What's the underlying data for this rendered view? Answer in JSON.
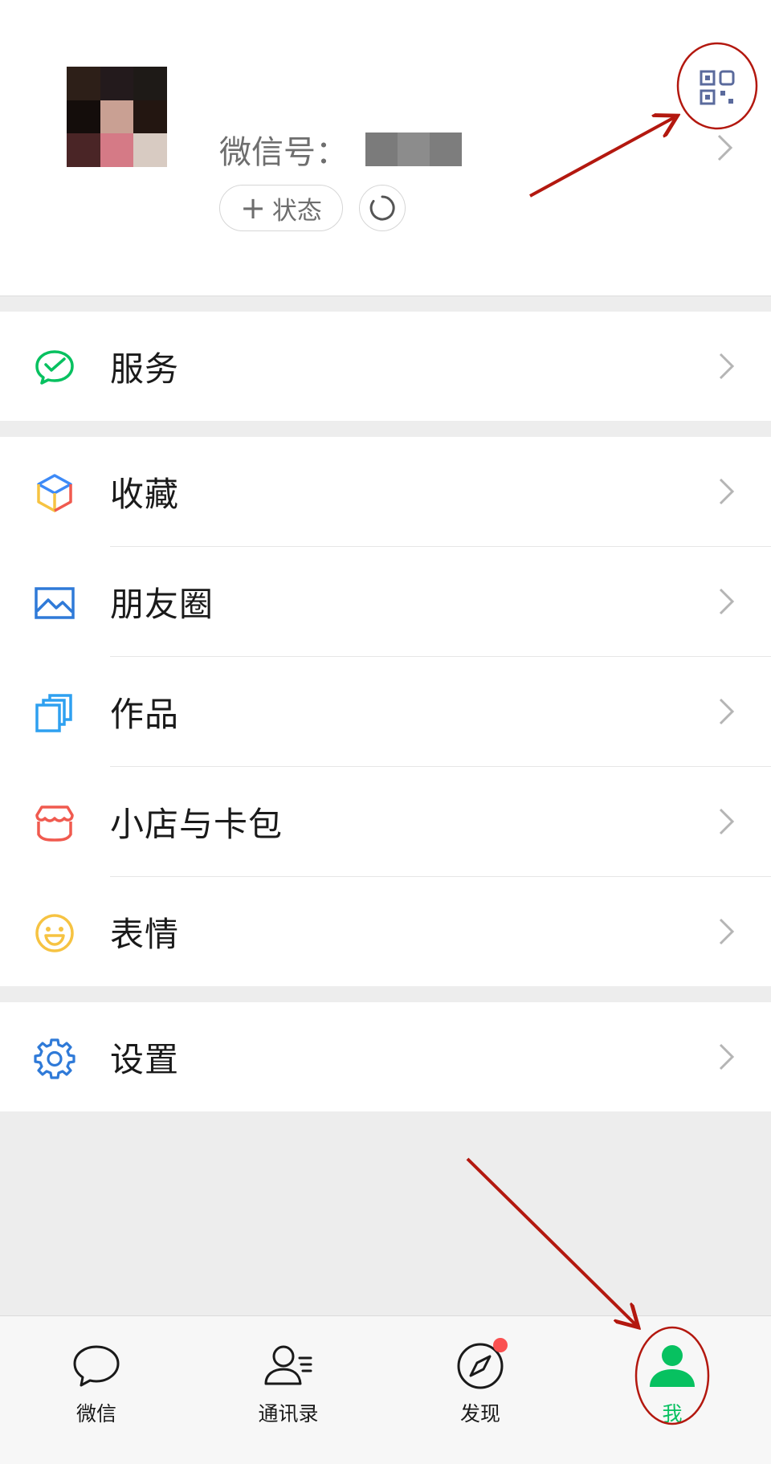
{
  "profile": {
    "wechat_id_label": "微信号：",
    "status_label": "状态",
    "avatar_color": "#c9a093"
  },
  "menu": {
    "group1": [
      {
        "label": "服务",
        "icon": "wechat-pay-icon",
        "color": "#07c160"
      }
    ],
    "group2": [
      {
        "label": "收藏",
        "icon": "cube-icon",
        "color": "#3d8af7"
      },
      {
        "label": "朋友圈",
        "icon": "landscape-icon",
        "color": "#2f7ad8"
      },
      {
        "label": "作品",
        "icon": "stacked-cards-icon",
        "color": "#2ea0f0"
      },
      {
        "label": "小店与卡包",
        "icon": "shop-icon",
        "color": "#f05a4f"
      },
      {
        "label": "表情",
        "icon": "smiley-icon",
        "color": "#f6c342"
      }
    ],
    "group3": [
      {
        "label": "设置",
        "icon": "gear-icon",
        "color": "#2f7ad8"
      }
    ]
  },
  "tabbar": {
    "tabs": [
      {
        "label": "微信",
        "icon": "chat-bubble-icon",
        "active": false
      },
      {
        "label": "通讯录",
        "icon": "contacts-icon",
        "active": false
      },
      {
        "label": "发现",
        "icon": "compass-icon",
        "active": false,
        "badge": true
      },
      {
        "label": "我",
        "icon": "person-icon",
        "active": true
      }
    ],
    "active_color": "#07c160"
  },
  "annotations": {
    "color": "#b3180f"
  }
}
